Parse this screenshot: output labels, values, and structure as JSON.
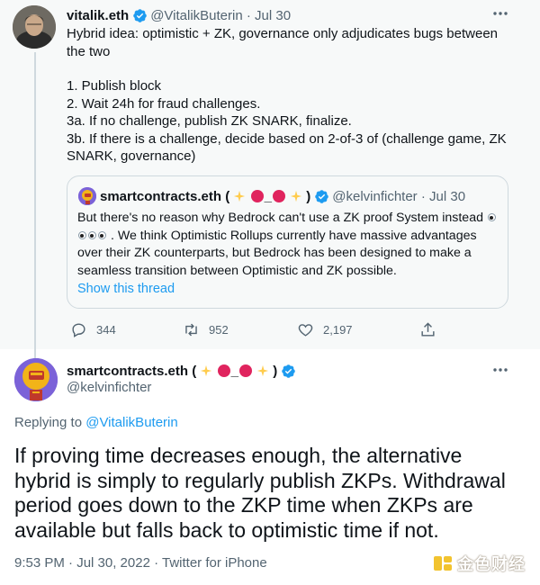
{
  "parent_tweet": {
    "author_name": "vitalik.eth",
    "handle": "@VitalikButerin",
    "date": "Jul 30",
    "text_intro": "Hybrid idea: optimistic + ZK, governance only adjudicates bugs between the two",
    "list": [
      "1. Publish block",
      "2. Wait 24h for fraud challenges.",
      "3a. If no challenge, publish ZK SNARK, finalize.",
      "3b. If there is a challenge, decide based on 2-of-3 of (challenge game, ZK SNARK, governance)"
    ],
    "quote": {
      "author_name": "smartcontracts.eth (",
      "author_name_sep": "_",
      "author_name_end": ")",
      "handle": "@kelvinfichter",
      "date": "Jul 30",
      "text_line1": "But there's no reason why Bedrock can't use a ZK proof System instead",
      "text_line2": ". We think Optimistic Rollups currently have massive advantages over their ZK counterparts, but Bedrock has been designed to make a seamless transition between Optimistic and ZK possible.",
      "show_thread": "Show this thread"
    },
    "actions": {
      "replies": "344",
      "retweets": "952",
      "likes": "2,197"
    }
  },
  "reply_tweet": {
    "author_name": "smartcontracts.eth (",
    "author_name_sep": "_",
    "author_name_end": ")",
    "handle": "@kelvinfichter",
    "replying_prefix": "Replying to",
    "replying_to": "@VitalikButerin",
    "text": "If proving time decreases enough, the alternative hybrid is simply to regularly publish ZKPs. Withdrawal period goes down to the ZKP time when ZKPs are available but falls back to optimistic time if not.",
    "timestamp": "9:53 PM · Jul 30, 2022 · Twitter for iPhone"
  },
  "watermark": {
    "text": "金色财经"
  },
  "colors": {
    "accent": "#1d9bf0",
    "muted": "#536471",
    "retweet": "#536471",
    "emoji_red": "#e0245e",
    "sparkle": "#ffcc4d"
  }
}
